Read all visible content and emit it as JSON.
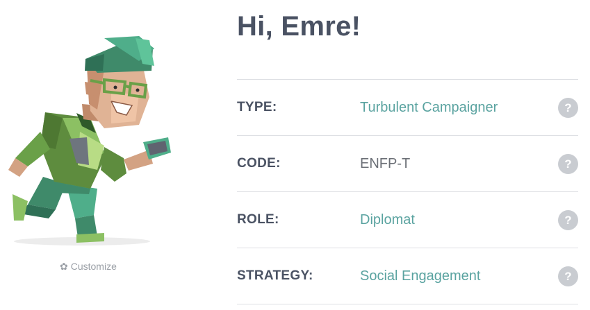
{
  "greeting": "Hi, Emre!",
  "avatar": {
    "customize_label": "Customize",
    "customize_icon": "gear-icon"
  },
  "traits": [
    {
      "label": "TYPE:",
      "value": "Turbulent Campaigner",
      "link": true
    },
    {
      "label": "CODE:",
      "value": "ENFP-T",
      "link": false
    },
    {
      "label": "ROLE:",
      "value": "Diplomat",
      "link": true
    },
    {
      "label": "STRATEGY:",
      "value": "Social Engagement",
      "link": true
    }
  ],
  "help_glyph": "?",
  "colors": {
    "heading": "#4a5263",
    "link": "#5aa3a0",
    "muted": "#9a9fa6",
    "help_badge": "#c9ccd1",
    "divider": "#dddfe3"
  }
}
